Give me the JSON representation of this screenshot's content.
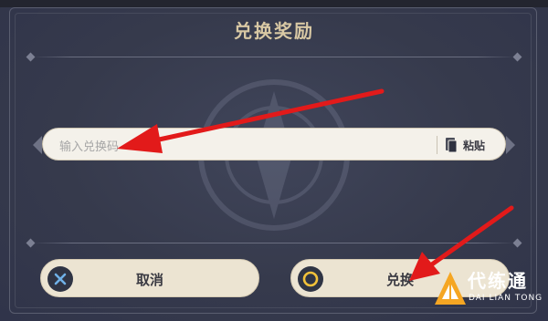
{
  "dialog": {
    "title": "兑换奖励"
  },
  "code_input": {
    "placeholder": "输入兑换码",
    "paste_label": "粘贴"
  },
  "buttons": {
    "cancel_label": "取消",
    "confirm_label": "兑换"
  },
  "watermark_logo": {
    "name": "代练通",
    "pinyin": "DAI LIAN TONG"
  },
  "colors": {
    "panel_bg": "#363a4c",
    "title_gold": "#d8c8a4",
    "input_bg": "#f4f1ea",
    "button_bg": "#ece4d2",
    "arrow_red": "#e21a1a",
    "logo_orange": "#f5a623"
  },
  "icons": {
    "cancel": "x-circle-icon",
    "confirm": "o-circle-icon",
    "paste": "clipboard-icon"
  }
}
